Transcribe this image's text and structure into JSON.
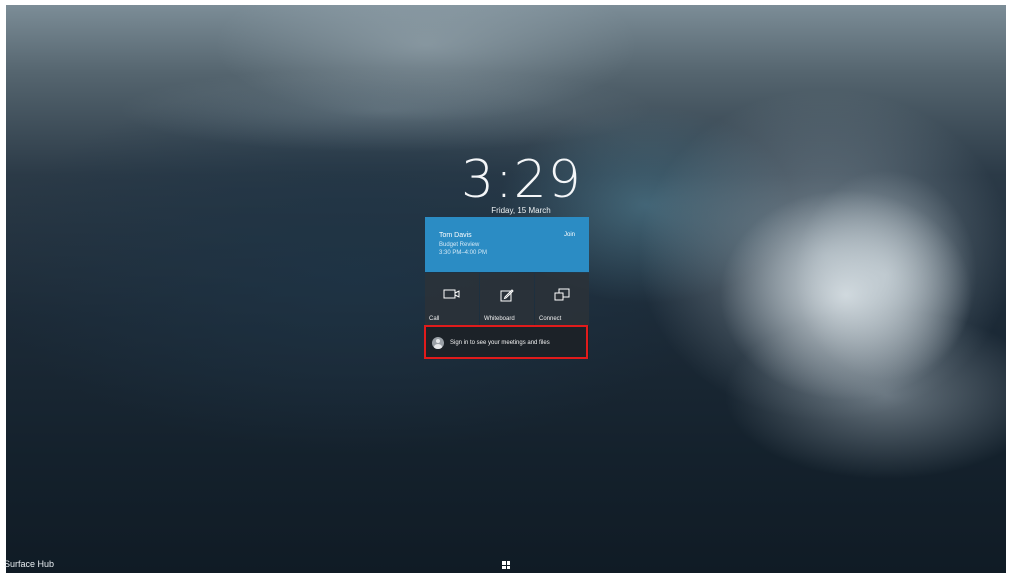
{
  "lockscreen": {
    "time": "3:29",
    "date": "Friday, 15 March"
  },
  "meeting": {
    "organizer": "Tom Davis",
    "subject": "Budget Review",
    "time": "3:30 PM–4:00 PM",
    "join_label": "Join",
    "accent_color": "#2b8cc4"
  },
  "actions": [
    {
      "label": "Call",
      "icon": "video-camera-icon"
    },
    {
      "label": "Whiteboard",
      "icon": "pen-square-icon"
    },
    {
      "label": "Connect",
      "icon": "project-screen-icon"
    }
  ],
  "signin": {
    "text": "Sign in to see your meetings and files",
    "icon": "person-avatar-icon",
    "highlight_color": "#e11b1b"
  },
  "taskbar": {
    "device_name": "Surface Hub",
    "start_icon": "windows-logo-icon"
  }
}
